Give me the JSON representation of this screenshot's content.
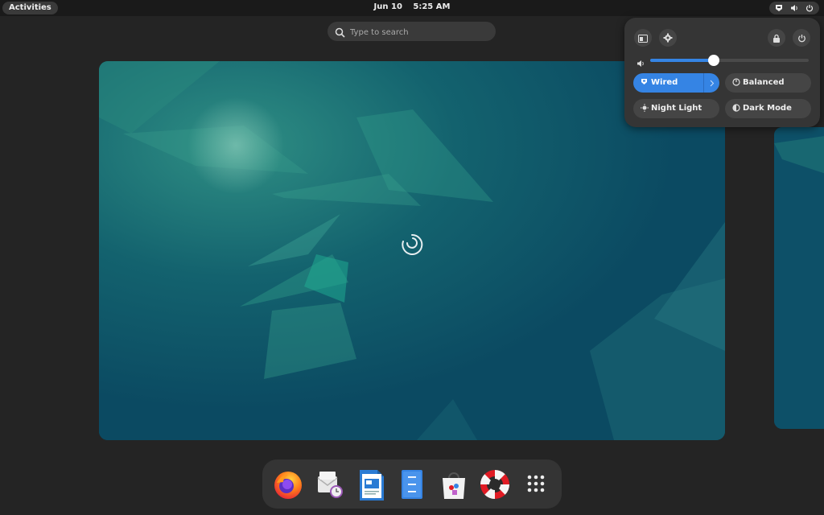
{
  "topbar": {
    "activities_label": "Activities",
    "date": "Jun 10",
    "time": "5:25 AM"
  },
  "search": {
    "placeholder": "Type to search"
  },
  "quick_settings": {
    "volume_level": 0.4,
    "toggles": [
      {
        "label": "Wired",
        "icon": "network-icon",
        "active": true
      },
      {
        "label": "Balanced",
        "icon": "power-profile-icon",
        "active": false
      },
      {
        "label": "Night Light",
        "icon": "night-light-icon",
        "active": false
      },
      {
        "label": "Dark Mode",
        "icon": "dark-mode-icon",
        "active": false
      }
    ]
  },
  "dock": {
    "apps": [
      {
        "icon": "firefox-icon"
      },
      {
        "icon": "evolution-mail-icon"
      },
      {
        "icon": "libreoffice-writer-icon"
      },
      {
        "icon": "file-manager-icon"
      },
      {
        "icon": "software-store-icon"
      },
      {
        "icon": "help-icon"
      },
      {
        "icon": "show-apps-icon"
      }
    ]
  },
  "colors": {
    "accent": "#3584e4",
    "panel_bg": "#353535",
    "desktop_bg": "#242424",
    "wallpaper": "#0f5066"
  }
}
